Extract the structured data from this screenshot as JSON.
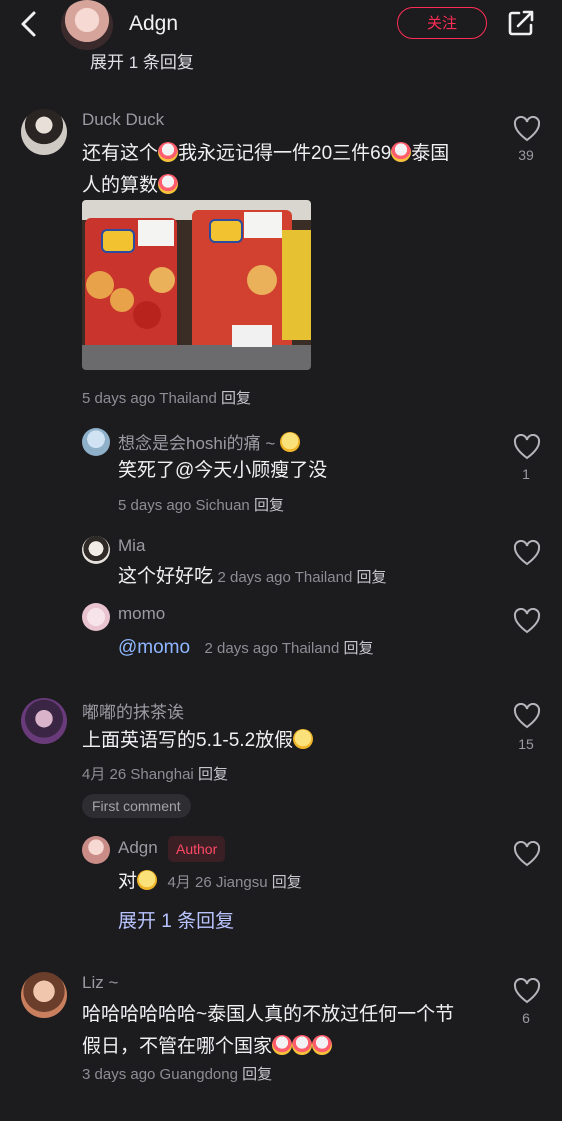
{
  "header": {
    "name": "Adgn",
    "follow_label": "关注",
    "cut_text": "展开 1 条回复"
  },
  "colors": {
    "accent": "#ff2d55",
    "background": "#1c1c1f",
    "muted": "#8d8d95"
  },
  "icons": {
    "back": "chevron-left-icon",
    "share": "share-icon",
    "like": "heart-outline-icon"
  },
  "comments": [
    {
      "user": "Duck Duck",
      "text_a": "还有这个",
      "text_b": "我永远记得一件20三件69",
      "text_c": "泰国",
      "text_d": "人的算数",
      "meta": "5 days ago Thailand",
      "reply": "回复",
      "likes": "39"
    },
    {
      "user": "想念是会hoshi的痛 ~",
      "text": "笑死了@今天小顾瘦了没",
      "meta": "5 days ago Sichuan",
      "reply": "回复",
      "likes": "1"
    },
    {
      "user": "Mia",
      "text": "这个好好吃",
      "meta": "2 days ago Thailand",
      "reply": "回复"
    },
    {
      "user": "momo",
      "text": "@momo",
      "meta": "2 days ago Thailand",
      "reply": "回复"
    },
    {
      "user": "嘟嘟的抹茶诶",
      "text": "上面英语写的5.1-5.2放假",
      "meta": "4月 26 Shanghai",
      "reply": "回复",
      "likes": "15",
      "tag": "First comment"
    },
    {
      "user": "Adgn",
      "author_tag": "Author",
      "text": "对",
      "meta": "4月 26 Jiangsu",
      "reply": "回复",
      "expand": "展开 1 条回复"
    },
    {
      "user": "Liz ~",
      "text_line1": "哈哈哈哈哈哈~泰国人真的不放过任何一个节",
      "text_line2": "假日，不管在哪个国家",
      "meta": "3 days ago Guangdong",
      "reply": "回复",
      "likes": "6"
    }
  ]
}
